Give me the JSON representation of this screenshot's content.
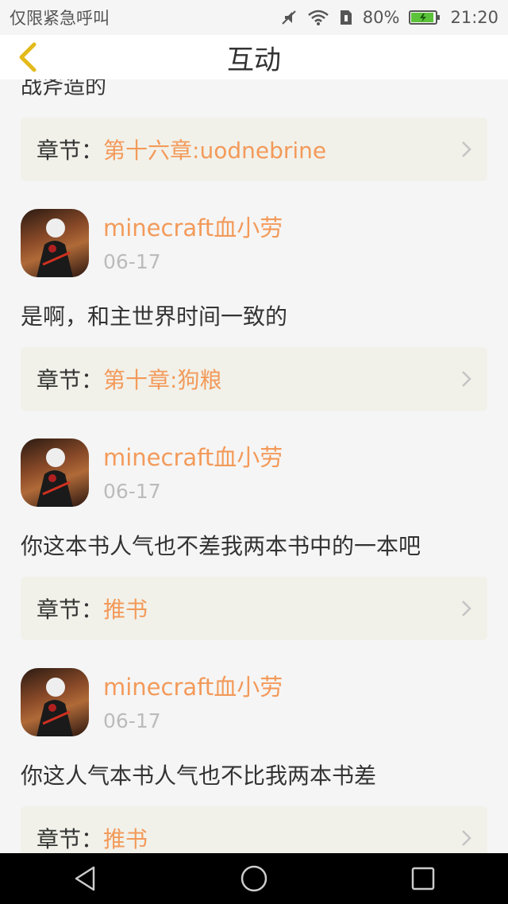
{
  "status_bar": {
    "carrier": "仅限紧急呼叫",
    "battery": "80%",
    "time": "21:20"
  },
  "header": {
    "title": "互动"
  },
  "first_post_text": "战斧造的",
  "chapter_label": "章节：",
  "posts": [
    {
      "chapter": "第十六章:uodnebrine"
    },
    {
      "username": "minecraft血小劳",
      "date": "06-17",
      "text": "是啊，和主世界时间一致的",
      "chapter": "第十章:狗粮"
    },
    {
      "username": "minecraft血小劳",
      "date": "06-17",
      "text": "你这本书人气也不差我两本书中的一本吧",
      "chapter": "推书"
    },
    {
      "username": "minecraft血小劳",
      "date": "06-17",
      "text": "你这人气本书人气也不比我两本书差",
      "chapter": "推书"
    }
  ],
  "colors": {
    "accent": "#f39a5a",
    "chapter_bg": "#f1f1ea",
    "text": "#333333",
    "muted": "#bbbbbb"
  }
}
